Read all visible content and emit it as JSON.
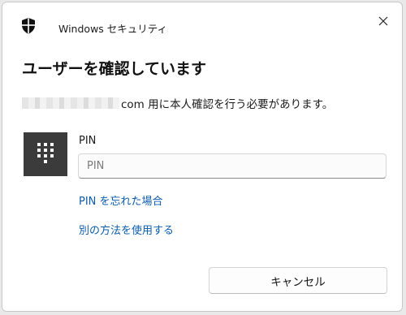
{
  "window": {
    "app_title": "Windows セキュリティ",
    "close_icon": "close-icon",
    "app_icon": "shield-icon"
  },
  "dialog": {
    "heading": "ユーザーを確認しています",
    "message_suffix": "com 用に本人確認を行う必要があります。",
    "pin_label": "PIN",
    "pin_placeholder": "PIN",
    "pin_value": "",
    "forgot_pin_link": "PIN を忘れた場合",
    "other_method_link": "別の方法を使用する",
    "cancel_button": "キャンセル",
    "keypad_icon": "keypad-icon"
  },
  "colors": {
    "link": "#0b5cad",
    "keypad_tile": "#3b3b3b",
    "background": "#ffffff"
  }
}
